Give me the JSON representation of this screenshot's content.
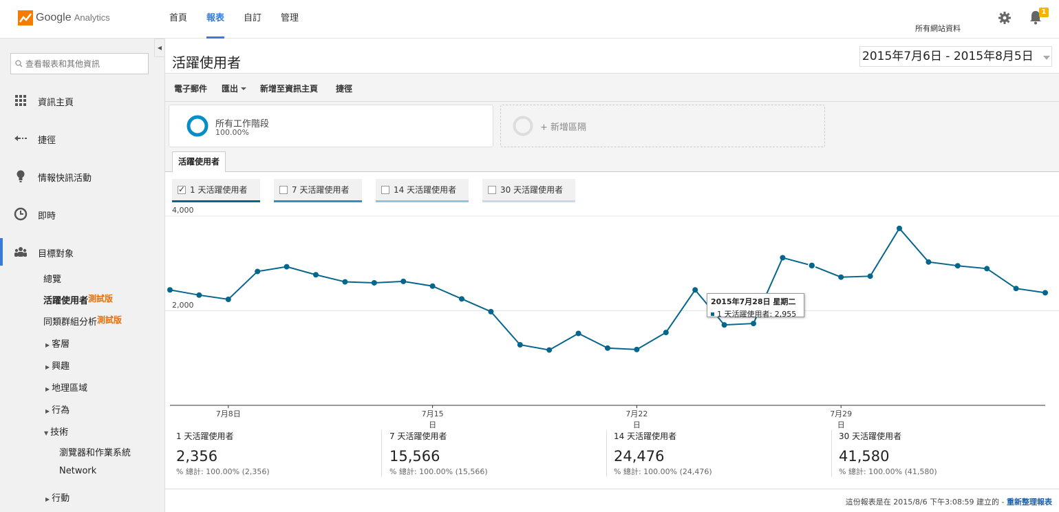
{
  "header": {
    "logo_text_main": "Google",
    "logo_text_sub": "Analytics",
    "nav": [
      "首頁",
      "報表",
      "自訂",
      "管理"
    ],
    "active_nav": 1,
    "account": "所有網站資料",
    "notification_count": "1"
  },
  "sidebar": {
    "search_placeholder": "查看報表和其他資訊",
    "main_items": [
      "資訊主頁",
      "捷徑",
      "情報快訊活動",
      "即時",
      "目標對象"
    ],
    "sub_items": {
      "overview": "總覽",
      "active_users": "活躍使用者",
      "active_users_beta": "測試版",
      "cohort": "同類群組分析",
      "cohort_beta": "測試版",
      "demographics": "客層",
      "interests": "興趣",
      "geo": "地理區域",
      "behavior": "行為",
      "technology": "技術",
      "browser_os": "瀏覽器和作業系統",
      "network": "Network",
      "mobile": "行動"
    }
  },
  "main": {
    "title": "活躍使用者",
    "date_range": "2015年7月6日 - 2015年8月5日",
    "toolbar": {
      "email": "電子郵件",
      "export": "匯出",
      "add_dashboard": "新增至資訊主頁",
      "shortcut": "捷徑"
    },
    "segment": {
      "name": "所有工作階段",
      "pct": "100.00%",
      "add_label": "+ 新增區隔"
    },
    "tab": "活躍使用者",
    "metric_toggles": [
      {
        "label": "1 天活躍使用者",
        "checked": true,
        "color": "#05668d"
      },
      {
        "label": "7 天活躍使用者",
        "checked": false,
        "color": "#2f8fc1"
      },
      {
        "label": "14 天活躍使用者",
        "checked": false,
        "color": "#8fc4e0"
      },
      {
        "label": "30 天活躍使用者",
        "checked": false,
        "color": "#c3dcea"
      }
    ],
    "tooltip": {
      "title": "2015年7月28日 星期二",
      "value": "1 天活躍使用者: 2,955"
    },
    "summaries": [
      {
        "label": "1 天活躍使用者",
        "value": "2,356",
        "pct": "% 總計: 100.00% (2,356)"
      },
      {
        "label": "7 天活躍使用者",
        "value": "15,566",
        "pct": "% 總計: 100.00% (15,566)"
      },
      {
        "label": "14 天活躍使用者",
        "value": "24,476",
        "pct": "% 總計: 100.00% (24,476)"
      },
      {
        "label": "30 天活躍使用者",
        "value": "41,580",
        "pct": "% 總計: 100.00% (41,580)"
      }
    ],
    "footer_text": "這份報表是在 2015/8/6 下午3:08:59 建立的 -",
    "footer_link": "重新整理報表"
  },
  "chart_data": {
    "type": "line",
    "x": [
      "2015-07-06",
      "2015-07-07",
      "2015-07-08",
      "2015-07-09",
      "2015-07-10",
      "2015-07-11",
      "2015-07-12",
      "2015-07-13",
      "2015-07-14",
      "2015-07-15",
      "2015-07-16",
      "2015-07-17",
      "2015-07-18",
      "2015-07-19",
      "2015-07-20",
      "2015-07-21",
      "2015-07-22",
      "2015-07-23",
      "2015-07-24",
      "2015-07-25",
      "2015-07-26",
      "2015-07-27",
      "2015-07-28",
      "2015-07-29",
      "2015-07-30",
      "2015-07-31",
      "2015-08-01",
      "2015-08-02",
      "2015-08-03",
      "2015-08-04",
      "2015-08-05"
    ],
    "x_tick_labels": [
      "7月8日",
      "7月15日",
      "7月22日",
      "7月29日"
    ],
    "x_tick_dates": [
      "2015-07-08",
      "2015-07-15",
      "2015-07-22",
      "2015-07-29"
    ],
    "series": [
      {
        "name": "1 天活躍使用者",
        "color": "#05668d",
        "values": [
          2440,
          2330,
          2240,
          2830,
          2930,
          2760,
          2610,
          2590,
          2620,
          2520,
          2250,
          1980,
          1280,
          1170,
          1520,
          1210,
          1180,
          1540,
          2440,
          1700,
          1730,
          3120,
          2955,
          2710,
          2730,
          3740,
          3030,
          2950,
          2890,
          2470,
          2380
        ]
      }
    ],
    "y_ticks": [
      2000,
      4000
    ],
    "ylim": [
      0,
      4000
    ],
    "grid": true
  }
}
